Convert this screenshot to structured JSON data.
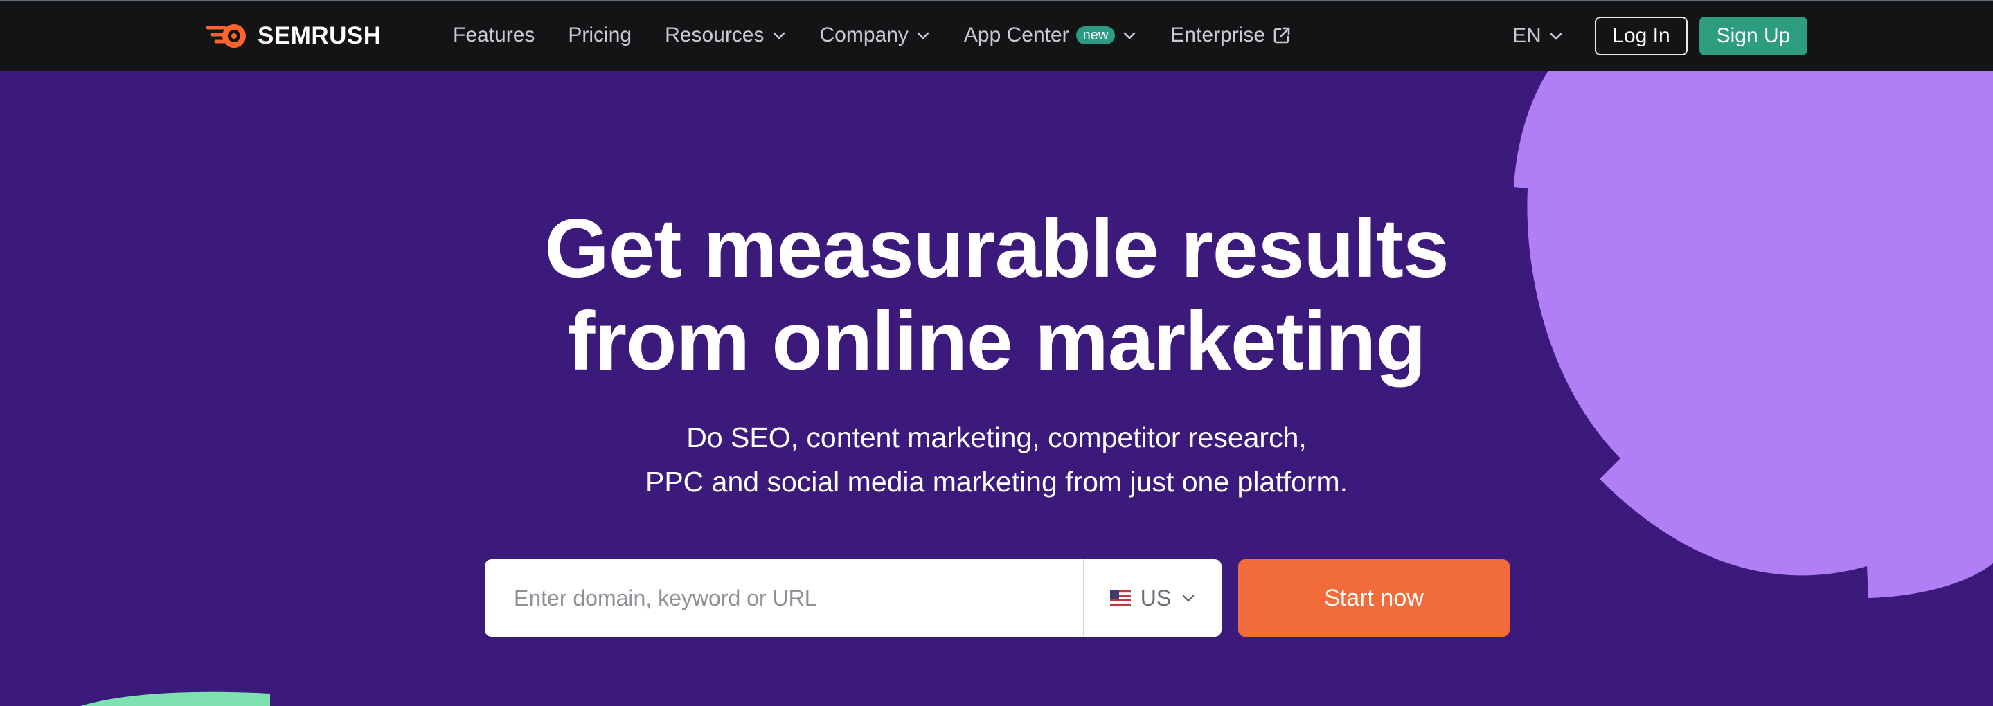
{
  "brand": {
    "name": "SEMRUSH",
    "logo_icon": "semrush-flame-icon",
    "accent": "#ff642d"
  },
  "nav": {
    "items": [
      {
        "label": "Features",
        "has_dropdown": false
      },
      {
        "label": "Pricing",
        "has_dropdown": false
      },
      {
        "label": "Resources",
        "has_dropdown": true
      },
      {
        "label": "Company",
        "has_dropdown": true
      },
      {
        "label": "App Center",
        "badge": "new",
        "has_dropdown": true
      },
      {
        "label": "Enterprise",
        "external": true
      }
    ],
    "language": "EN",
    "login_label": "Log In",
    "signup_label": "Sign Up"
  },
  "hero": {
    "headline_line1": "Get measurable results",
    "headline_line2": "from online marketing",
    "sub_line1": "Do SEO, content marketing, competitor research,",
    "sub_line2": "PPC and social media marketing from just one platform.",
    "search": {
      "placeholder": "Enter domain, keyword or URL",
      "value": "",
      "country": "US",
      "country_flag_icon": "us-flag-icon"
    },
    "cta_label": "Start now"
  },
  "colors": {
    "nav_bg": "#131416",
    "hero_bg": "#3c1a7c",
    "deco_purple": "#b07ff5",
    "deco_green": "#7ee2b0",
    "signup_bg": "#2e9c7f",
    "cta_bg": "#f26b3a",
    "badge_bg": "#2b9c83"
  }
}
